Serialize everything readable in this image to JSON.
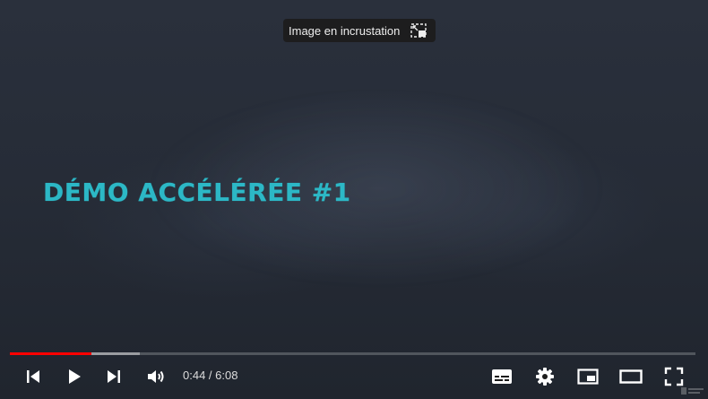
{
  "video": {
    "overlay_title": "DÉMO ACCÉLÉRÉE #1",
    "title_color": "#2cb8c6"
  },
  "pip_tooltip": {
    "label": "Image en incrustation",
    "icon": "picture-in-picture-exit-icon"
  },
  "player": {
    "current_time": "0:44",
    "duration": "6:08",
    "time_display": "0:44 / 6:08",
    "progress_played_fraction": 0.1196,
    "progress_buffered_fraction": 0.19,
    "played_color": "#ff0000"
  },
  "controls": {
    "left": [
      "previous-icon",
      "play-icon",
      "next-icon",
      "volume-icon"
    ],
    "right": [
      "subtitles-icon",
      "settings-icon",
      "miniplayer-icon",
      "theater-mode-icon",
      "fullscreen-icon"
    ]
  }
}
